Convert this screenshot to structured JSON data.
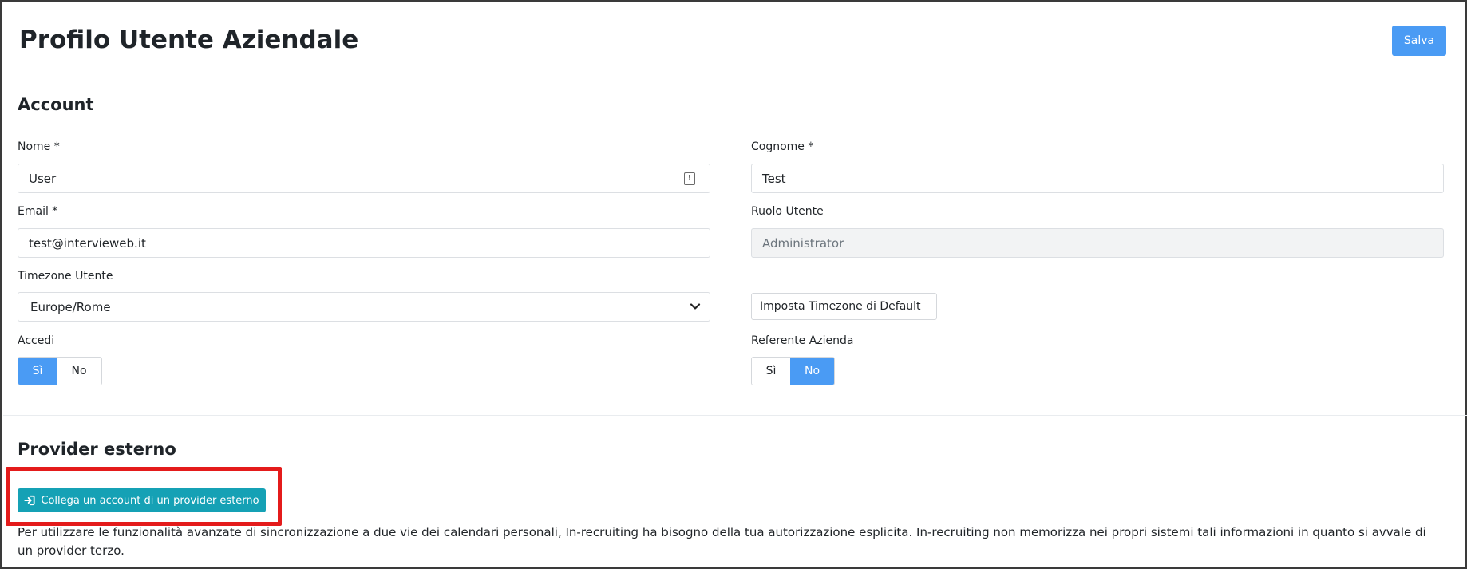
{
  "header": {
    "title": "Profilo Utente Aziendale",
    "save_label": "Salva"
  },
  "account": {
    "section_title": "Account",
    "nome_label": "Nome *",
    "nome_value": "User",
    "cognome_label": "Cognome *",
    "cognome_value": "Test",
    "email_label": "Email *",
    "email_value": "test@intervieweb.it",
    "ruolo_label": "Ruolo Utente",
    "ruolo_value": "Administrator",
    "timezone_label": "Timezone Utente",
    "timezone_value": "Europe/Rome",
    "default_timezone_button": "Imposta Timezone di Default",
    "accedi_label": "Accedi",
    "accedi_options": [
      "Sì",
      "No"
    ],
    "accedi_selected": "Sì",
    "referente_label": "Referente Azienda",
    "referente_options": [
      "Sì",
      "No"
    ],
    "referente_selected": "No"
  },
  "provider": {
    "section_title": "Provider esterno",
    "connect_button": "Collega un account di un provider esterno",
    "connect_icon": "sign-in-icon",
    "note": "Per utilizzare le funzionalità avanzate di sincronizzazione a due vie dei calendari personali, In-recruiting ha bisogno della tua autorizzazione esplicita. In-recruiting non memorizza nei propri sistemi tali informazioni in quanto si avvale di un provider terzo."
  },
  "colors": {
    "primary": "#4a9bf4",
    "info": "#15a1b5",
    "highlight": "#e41b1b"
  }
}
